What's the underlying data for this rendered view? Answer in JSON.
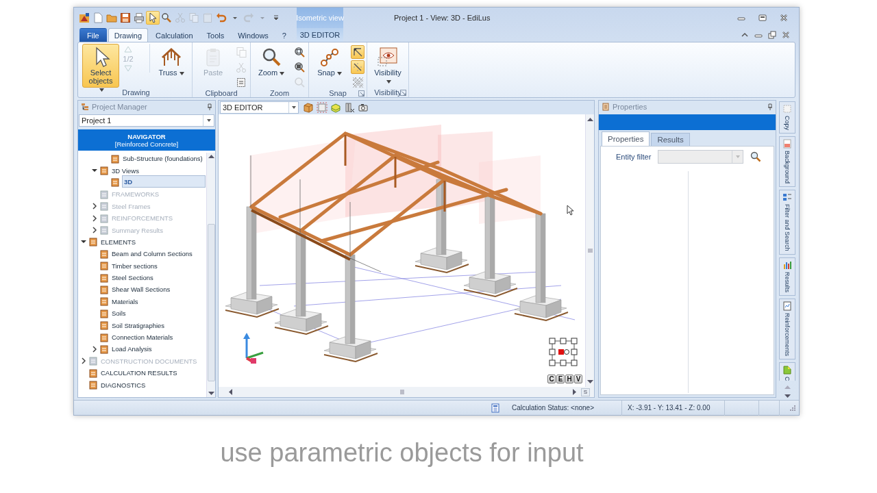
{
  "window": {
    "title": "Project 1 - View: 3D - EdiLus"
  },
  "quick_access": [
    {
      "selected": false,
      "disabled": false
    },
    {
      "selected": false,
      "disabled": false
    },
    {
      "selected": false,
      "disabled": false
    },
    {
      "selected": false,
      "disabled": false
    },
    {
      "selected": false,
      "disabled": false
    },
    {
      "selected": true,
      "disabled": false
    },
    {
      "selected": false,
      "disabled": false
    },
    {
      "selected": false,
      "disabled": true
    },
    {
      "selected": false,
      "disabled": true
    },
    {
      "selected": false,
      "disabled": true
    },
    {
      "selected": false,
      "disabled": false
    },
    {
      "selected": false,
      "disabled": false
    },
    {
      "selected": false,
      "disabled": true
    },
    {
      "selected": false,
      "disabled": true
    },
    {
      "selected": false,
      "disabled": false
    }
  ],
  "context_tab": {
    "header": "Isometric view",
    "label": "3D EDITOR",
    "selected": false
  },
  "ribbon_tabs": [
    {
      "label": "File",
      "kind": "file",
      "selected": false
    },
    {
      "label": "Drawing",
      "kind": "tab",
      "selected": true
    },
    {
      "label": "Calculation",
      "kind": "tab",
      "selected": false
    },
    {
      "label": "Tools",
      "kind": "tab",
      "selected": false
    },
    {
      "label": "Windows",
      "kind": "tab",
      "selected": false
    },
    {
      "label": "?",
      "kind": "tab",
      "selected": false
    }
  ],
  "ribbon_groups": [
    {
      "label": "Drawing",
      "launcher": false,
      "controls": [
        {
          "kind": "large",
          "label": "Select objects",
          "dropdown": true,
          "selected": true,
          "disabled": false
        },
        {
          "kind": "pager",
          "label": "1/2",
          "disabled": true
        },
        {
          "kind": "large",
          "label": "Truss",
          "dropdown": true,
          "selected": false,
          "disabled": false
        }
      ]
    },
    {
      "label": "Clipboard",
      "launcher": false,
      "controls": [
        {
          "kind": "large",
          "label": "Paste",
          "dropdown": false,
          "selected": false,
          "disabled": true
        },
        {
          "kind": "stack",
          "items": [
            {
              "selected": false,
              "disabled": true
            },
            {
              "selected": false,
              "disabled": true
            },
            {
              "selected": false,
              "disabled": false
            }
          ]
        }
      ]
    },
    {
      "label": "Zoom",
      "launcher": false,
      "controls": [
        {
          "kind": "large",
          "label": "Zoom",
          "dropdown": true,
          "selected": false,
          "disabled": false
        },
        {
          "kind": "stack",
          "items": [
            {
              "selected": false,
              "disabled": false
            },
            {
              "selected": false,
              "disabled": false
            },
            {
              "selected": false,
              "disabled": true
            }
          ]
        }
      ]
    },
    {
      "label": "Snap",
      "launcher": true,
      "controls": [
        {
          "kind": "large",
          "label": "Snap",
          "dropdown": true,
          "selected": false,
          "disabled": false
        },
        {
          "kind": "stack",
          "items": [
            {
              "selected": true,
              "disabled": false
            },
            {
              "selected": true,
              "disabled": false
            },
            {
              "selected": false,
              "disabled": false
            }
          ]
        }
      ]
    },
    {
      "label": "Visibility",
      "launcher": true,
      "controls": [
        {
          "kind": "large",
          "label": "Visibility",
          "dropdown": true,
          "selected": false,
          "disabled": false
        }
      ]
    }
  ],
  "project_manager": {
    "title": "Project Manager",
    "project": "Project 1",
    "navigator": {
      "title": "NAVIGATOR",
      "subtitle": "[Reinforced Concrete]"
    },
    "tree": [
      {
        "children": [
          {
            "children": [
              {
                "label": "Sub-Structure (foundations)",
                "disabled": false,
                "selected": false
              }
            ]
          },
          {
            "label": "3D Views",
            "expanded": true,
            "disabled": false,
            "selected": false,
            "children": [
              {
                "label": "3D",
                "disabled": false,
                "selected": true
              }
            ]
          },
          {
            "label": "FRAMEWORKS",
            "disabled": true,
            "selected": false
          },
          {
            "label": "Steel Frames",
            "expanded": false,
            "disabled": true,
            "selected": false
          },
          {
            "label": "REINFORCEMENTS",
            "expanded": false,
            "disabled": true,
            "selected": false
          },
          {
            "label": "Summary Results",
            "expanded": false,
            "disabled": true,
            "selected": false
          }
        ]
      },
      {
        "label": "ELEMENTS",
        "expanded": true,
        "disabled": false,
        "selected": false,
        "children": [
          {
            "label": "Beam and Column Sections",
            "disabled": false,
            "selected": false
          },
          {
            "label": "Timber sections",
            "disabled": false,
            "selected": false
          },
          {
            "label": "Steel Sections",
            "disabled": false,
            "selected": false
          },
          {
            "label": "Shear Wall Sections",
            "disabled": false,
            "selected": false
          },
          {
            "label": "Materials",
            "disabled": false,
            "selected": false
          },
          {
            "label": "Soils",
            "disabled": false,
            "selected": false
          },
          {
            "label": "Soil Stratigraphies",
            "disabled": false,
            "selected": false
          },
          {
            "label": "Connection Materials",
            "disabled": false,
            "selected": false
          },
          {
            "label": "Load Analysis",
            "expanded": false,
            "disabled": false,
            "selected": false
          }
        ]
      },
      {
        "label": "CONSTRUCTION DOCUMENTS",
        "expanded": false,
        "disabled": true,
        "selected": false
      },
      {
        "label": "CALCULATION RESULTS",
        "disabled": false,
        "selected": false
      },
      {
        "label": "DIAGNOSTICS",
        "disabled": false,
        "selected": false
      }
    ]
  },
  "editor": {
    "view": "3D EDITOR",
    "view_buttons": [
      {
        "label": "C"
      },
      {
        "label": "E"
      },
      {
        "label": "H"
      },
      {
        "label": "V"
      }
    ],
    "scroll_button": "S"
  },
  "properties": {
    "title": "Properties",
    "tabs": [
      {
        "label": "Properties",
        "selected": true
      },
      {
        "label": "Results",
        "selected": false
      }
    ],
    "filter_label": "Entity filter",
    "filter_disabled": true
  },
  "side_tabs": [
    {
      "label": "Copy"
    },
    {
      "label": "Background"
    },
    {
      "label": "Filter and Search"
    },
    {
      "label": "Results"
    },
    {
      "label": "Reinforcements"
    },
    {
      "label": "C"
    }
  ],
  "status_bar": {
    "calculation_status": "Calculation Status: <none>",
    "coordinates": "X: -3.91 - Y: 13.41 - Z: 0.00"
  },
  "caption": "use parametric objects for input"
}
